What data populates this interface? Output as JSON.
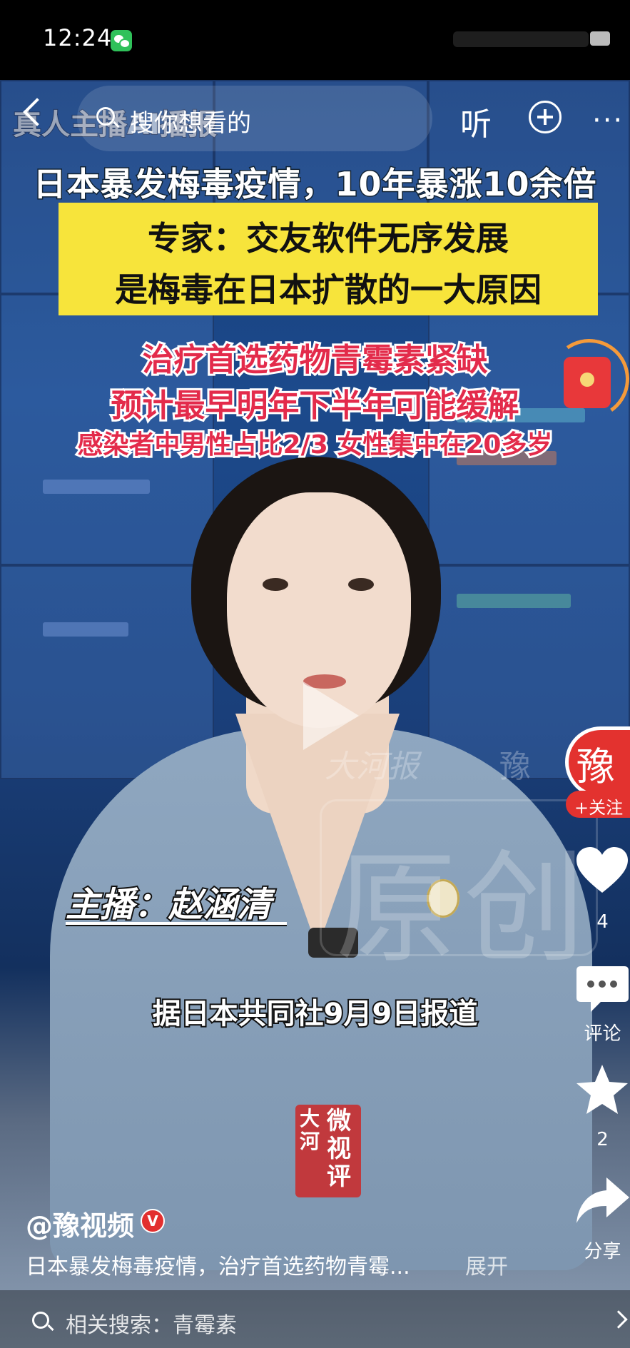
{
  "status_bar": {
    "time": "12:24"
  },
  "top_bar": {
    "search_placeholder": "搜你想看的",
    "listen_label": "听",
    "more_label": "···"
  },
  "video": {
    "program_label": "真人主播AI播报",
    "headline": "日本暴发梅毒疫情，10年暴涨10余倍",
    "expert_line1": "专家：交友软件无序发展",
    "expert_line2": "是梅毒在日本扩散的一大原因",
    "red_line1": "治疗首选药物青霉素紧缺",
    "red_line2": "预计最早明年下半年可能缓解",
    "red_line3": "感染者中男性占比2/3  女性集中在20多岁",
    "anchor_caption": "主播：赵涵清",
    "subtitle": "据日本共同社9月9日报道",
    "watermark_original": "原创",
    "logo_watermark": "大河报",
    "logo_watermark2": "豫",
    "seal_left": "大河",
    "seal_right": "微视评"
  },
  "right_rail": {
    "avatar_glyph": "豫",
    "follow_label": "+关注",
    "like_count": "4",
    "comment_label": "评论",
    "favorite_count": "2",
    "share_label": "分享"
  },
  "bottom": {
    "author": "@豫视频",
    "verified_label": "V",
    "caption": "日本暴发梅毒疫情，治疗首选药物青霉...",
    "expand_label": "展开",
    "related_search": "相关搜索：青霉素"
  },
  "colors": {
    "accent_red": "#e3322f",
    "highlight_yellow": "#f7e43b",
    "headline_red": "#e32b4b",
    "wechat_green": "#2fc15a"
  }
}
